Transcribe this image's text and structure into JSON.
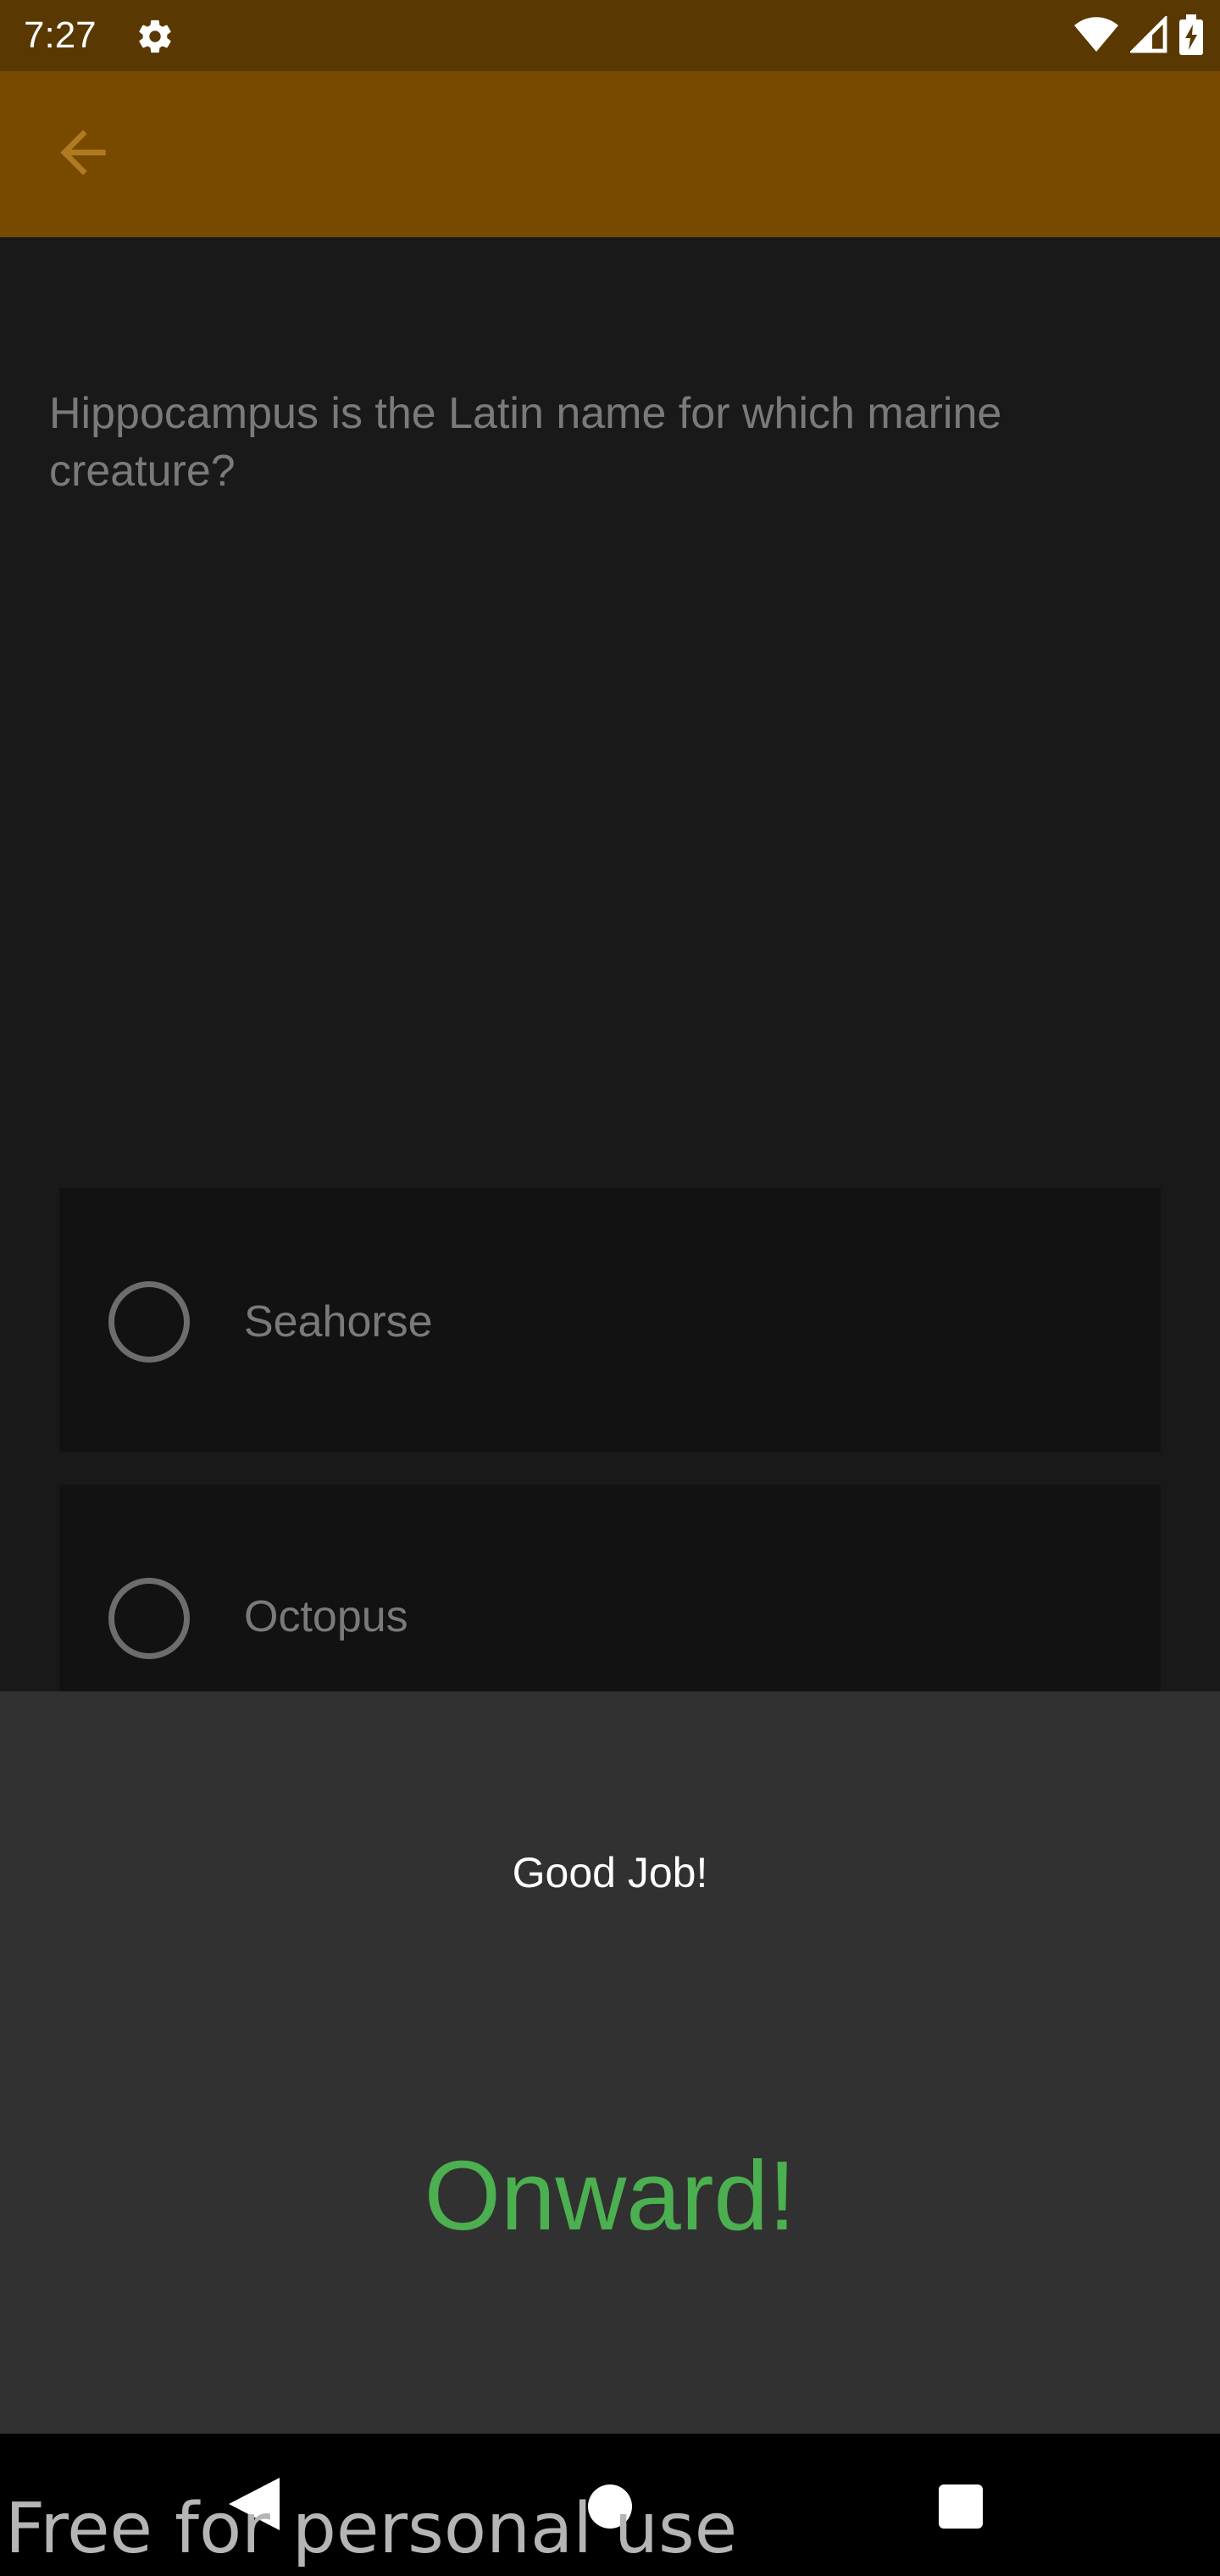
{
  "status_bar": {
    "time": "7:27",
    "icons": [
      "gear-icon",
      "wifi-icon",
      "signal-icon",
      "battery-charging-icon"
    ]
  },
  "app_bar": {
    "back_icon": "arrow-left-icon",
    "color": "#774a00"
  },
  "quiz": {
    "question": "Hippocampus is the Latin name for which marine creature?",
    "options": [
      {
        "label": "Seahorse",
        "selected": false
      },
      {
        "label": "Octopus",
        "selected": false
      }
    ]
  },
  "result_sheet": {
    "message": "Good Job!",
    "button_label": "Onward!",
    "button_color": "#4caf50"
  },
  "nav_bar": {
    "icons": [
      "back-triangle-icon",
      "home-circle-icon",
      "recents-square-icon"
    ]
  },
  "watermark": "Free for personal use"
}
